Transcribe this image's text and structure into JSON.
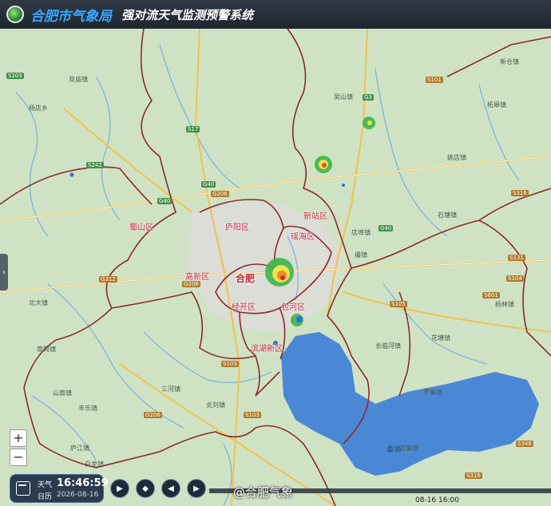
{
  "header": {
    "bureau": "合肥市气象局",
    "system": "强对流天气监测预警系统"
  },
  "districts": [
    {
      "name": "蜀山区"
    },
    {
      "name": "庐阳区"
    },
    {
      "name": "新站区"
    },
    {
      "name": "瑶海区"
    },
    {
      "name": "高新区"
    },
    {
      "name": "经开区"
    },
    {
      "name": "包河区"
    },
    {
      "name": "滨湖新区"
    }
  ],
  "city": "合肥",
  "lake": "巢湖",
  "roads": [
    "S203",
    "S242",
    "S17",
    "G40",
    "G206",
    "G40",
    "G3",
    "S101",
    "G40",
    "G312",
    "G206",
    "S105",
    "S104",
    "S601",
    "S131",
    "S103",
    "S103",
    "G206",
    "S346",
    "S316",
    "S316"
  ],
  "towns": [
    "双庙镇",
    "杨店乡",
    "吴山镇",
    "炎刘镇",
    "丰乐镇",
    "三河镇",
    "庐江镇",
    "长临河镇",
    "撮镇",
    "店埠镇",
    "花塘镇",
    "石塘镇",
    "杨林镇",
    "山南镇",
    "南岗镇",
    "新仓镇",
    "柘皋镇",
    "姚店镇",
    "北大镇",
    "白龙镇",
    "店集镇",
    "罗集镇"
  ],
  "zoom": {
    "in": "+",
    "out": "−"
  },
  "clock": {
    "label_weather": "天气",
    "label_calendar": "日历",
    "time": "16:46:59",
    "date": "2026-08-16"
  },
  "playback": [
    "▶",
    "◆",
    "◀",
    "▶"
  ],
  "timeline_label": "08-16 16:00",
  "watermark": "@合肥气象",
  "colors": {
    "header_bg": "#24303a",
    "bureau_text": "#3aa6ff",
    "boundary": "#8b2b2b",
    "lake": "#4a88d6",
    "land": "#cfe3c4",
    "district_label": "#c0263a"
  }
}
